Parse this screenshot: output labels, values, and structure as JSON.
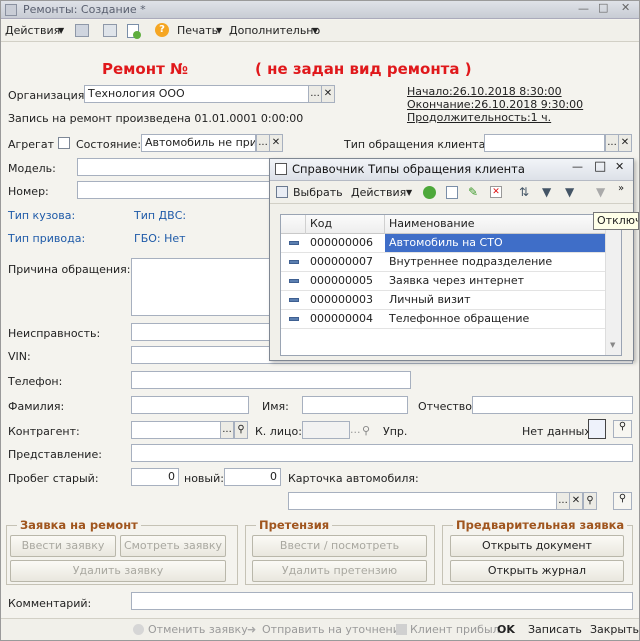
{
  "window": {
    "title": "Ремонты: Создание *"
  },
  "toolbar": {
    "actions": "Действия",
    "print": "Печать",
    "more": "Дополнительно"
  },
  "header": {
    "title": "Ремонт №",
    "repair_type": "( не задан вид ремонта )",
    "start": "Начало:26.10.2018 8:30:00",
    "end": "Окончание:26.10.2018 9:30:00",
    "duration": "Продолжительность:1 ч."
  },
  "form": {
    "org_label": "Организация:",
    "org_value": "Технология ООО",
    "record_text": "Запись на ремонт произведена 01.01.0001 0:00:00",
    "aggregate_label": "Агрегат",
    "state_label": "Состояние:",
    "state_value": "Автомобиль не прибы",
    "client_type_label": "Тип обращения клиента:",
    "model_label": "Модель:",
    "number_label": "Номер:",
    "body_type": "Тип кузова:",
    "engine_type": "Тип ДВС:",
    "drive_type": "Тип привода:",
    "gbo": "ГБО: Нет",
    "reason_label": "Причина обращения:",
    "fault_label": "Неисправность:",
    "vin_label": "VIN:",
    "phone_label": "Телефон:",
    "surname_label": "Фамилия:",
    "name_label": "Имя:",
    "patronymic_label": "Отчество:",
    "contractor_label": "Контрагент:",
    "contact_label": "К. лицо:",
    "contact_placeholder": "...",
    "upr_label": "Упр.",
    "no_data": "Нет данных.",
    "representation_label": "Представление:",
    "mileage_old_label": "Пробег старый:",
    "mileage_old": "0",
    "mileage_new_label": "новый:",
    "mileage_new": "0",
    "car_card_label": "Карточка автомобиля:",
    "comment_label": "Комментарий:"
  },
  "groups": {
    "repair_request": {
      "title": "Заявка на ремонт",
      "enter": "Ввести заявку",
      "view": "Смотреть заявку",
      "delete": "Удалить заявку"
    },
    "claim": {
      "title": "Претензия",
      "enter": "Ввести / посмотреть претензию",
      "delete": "Удалить претензию"
    },
    "pre_request": {
      "title": "Предварительная заявка",
      "open_doc": "Открыть документ",
      "open_journal": "Открыть журнал"
    }
  },
  "bottom": {
    "cancel": "Отменить заявку",
    "send": "Отправить на уточнение",
    "arrived": "Клиент прибыл",
    "ok": "OK",
    "save": "Записать",
    "close": "Закрыть"
  },
  "dialog": {
    "title": "Справочник Типы обращения клиента",
    "select": "Выбрать",
    "actions": "Действия",
    "col_code": "Код",
    "col_name": "Наименование",
    "tooltip": "Отключи",
    "rows": [
      {
        "code": "000000006",
        "name": "Автомобиль на СТО"
      },
      {
        "code": "000000007",
        "name": "Внутреннее подразделение"
      },
      {
        "code": "000000005",
        "name": "Заявка через интернет"
      },
      {
        "code": "000000003",
        "name": "Личный визит"
      },
      {
        "code": "000000004",
        "name": "Телефонное обращение"
      }
    ]
  },
  "colors": {
    "accent_red": "#e0181b",
    "link_blue": "#1e5aa8",
    "group_title": "#a0551e",
    "selection": "#3f6ec8"
  }
}
